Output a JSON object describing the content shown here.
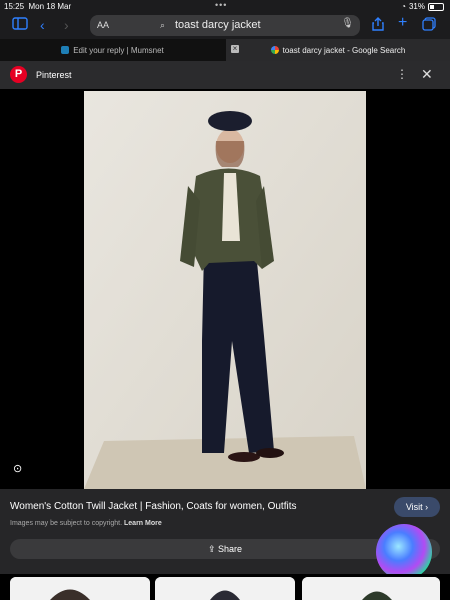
{
  "status_bar": {
    "time": "15:25",
    "date": "Mon 18 Mar",
    "battery": "31%"
  },
  "toolbar": {
    "reader_label": "AA",
    "url": "toast darcy jacket"
  },
  "tabs": [
    {
      "label": "Edit your reply | Mumsnet"
    },
    {
      "label": "toast darcy jacket - Google Search"
    }
  ],
  "source": {
    "name": "Pinterest"
  },
  "result": {
    "title": "Women's Cotton Twill Jacket | Fashion, Coats for women, Outfits",
    "visit_label": "Visit",
    "notice": "Images may be subject to copyright.",
    "learn_more": "Learn More",
    "share_label": "Share"
  },
  "colors": {
    "accent": "#2f80ff",
    "pinterest": "#e60023"
  }
}
